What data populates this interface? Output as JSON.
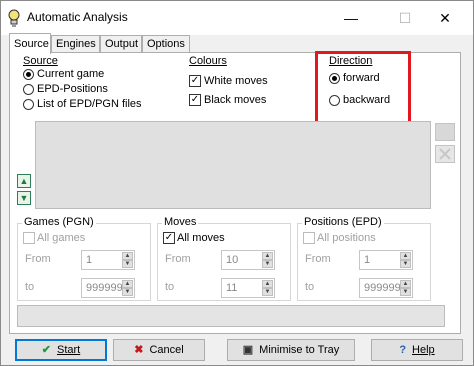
{
  "window": {
    "title": "Automatic Analysis",
    "minimize": "—",
    "maximize": "☐",
    "close": "✕"
  },
  "tabs": [
    {
      "label": "Source"
    },
    {
      "label": "Engines"
    },
    {
      "label": "Output"
    },
    {
      "label": "Options"
    }
  ],
  "source": {
    "label": "Source",
    "options": [
      {
        "label": "Current game",
        "selected": true
      },
      {
        "label": "EPD-Positions",
        "selected": false
      },
      {
        "label": "List of EPD/PGN files",
        "selected": false
      }
    ]
  },
  "colours": {
    "label": "Colours",
    "options": [
      {
        "label": "White moves",
        "checked": true
      },
      {
        "label": "Black moves",
        "checked": true
      }
    ]
  },
  "direction": {
    "label": "Direction",
    "options": [
      {
        "label": "forward",
        "selected": true
      },
      {
        "label": "backward",
        "selected": false
      }
    ]
  },
  "games": {
    "label": "Games (PGN)",
    "all_label": "All games",
    "all_checked": false,
    "from_label": "From",
    "to_label": "to",
    "from_value": "1",
    "to_value": "999999"
  },
  "moves": {
    "label": "Moves",
    "all_label": "All moves",
    "all_checked": true,
    "from_label": "From",
    "to_label": "to",
    "from_value": "10",
    "to_value": "11"
  },
  "positions": {
    "label": "Positions (EPD)",
    "all_label": "All positions",
    "all_checked": false,
    "from_label": "From",
    "to_label": "to",
    "from_value": "1",
    "to_value": "999999"
  },
  "buttons": {
    "start": "Start",
    "cancel": "Cancel",
    "minimise": "Minimise to Tray",
    "help": "Help"
  },
  "colors": {
    "highlight": "#e0191f",
    "arrow_green": "#1e7a3e",
    "default_button_border": "#0078d7"
  }
}
